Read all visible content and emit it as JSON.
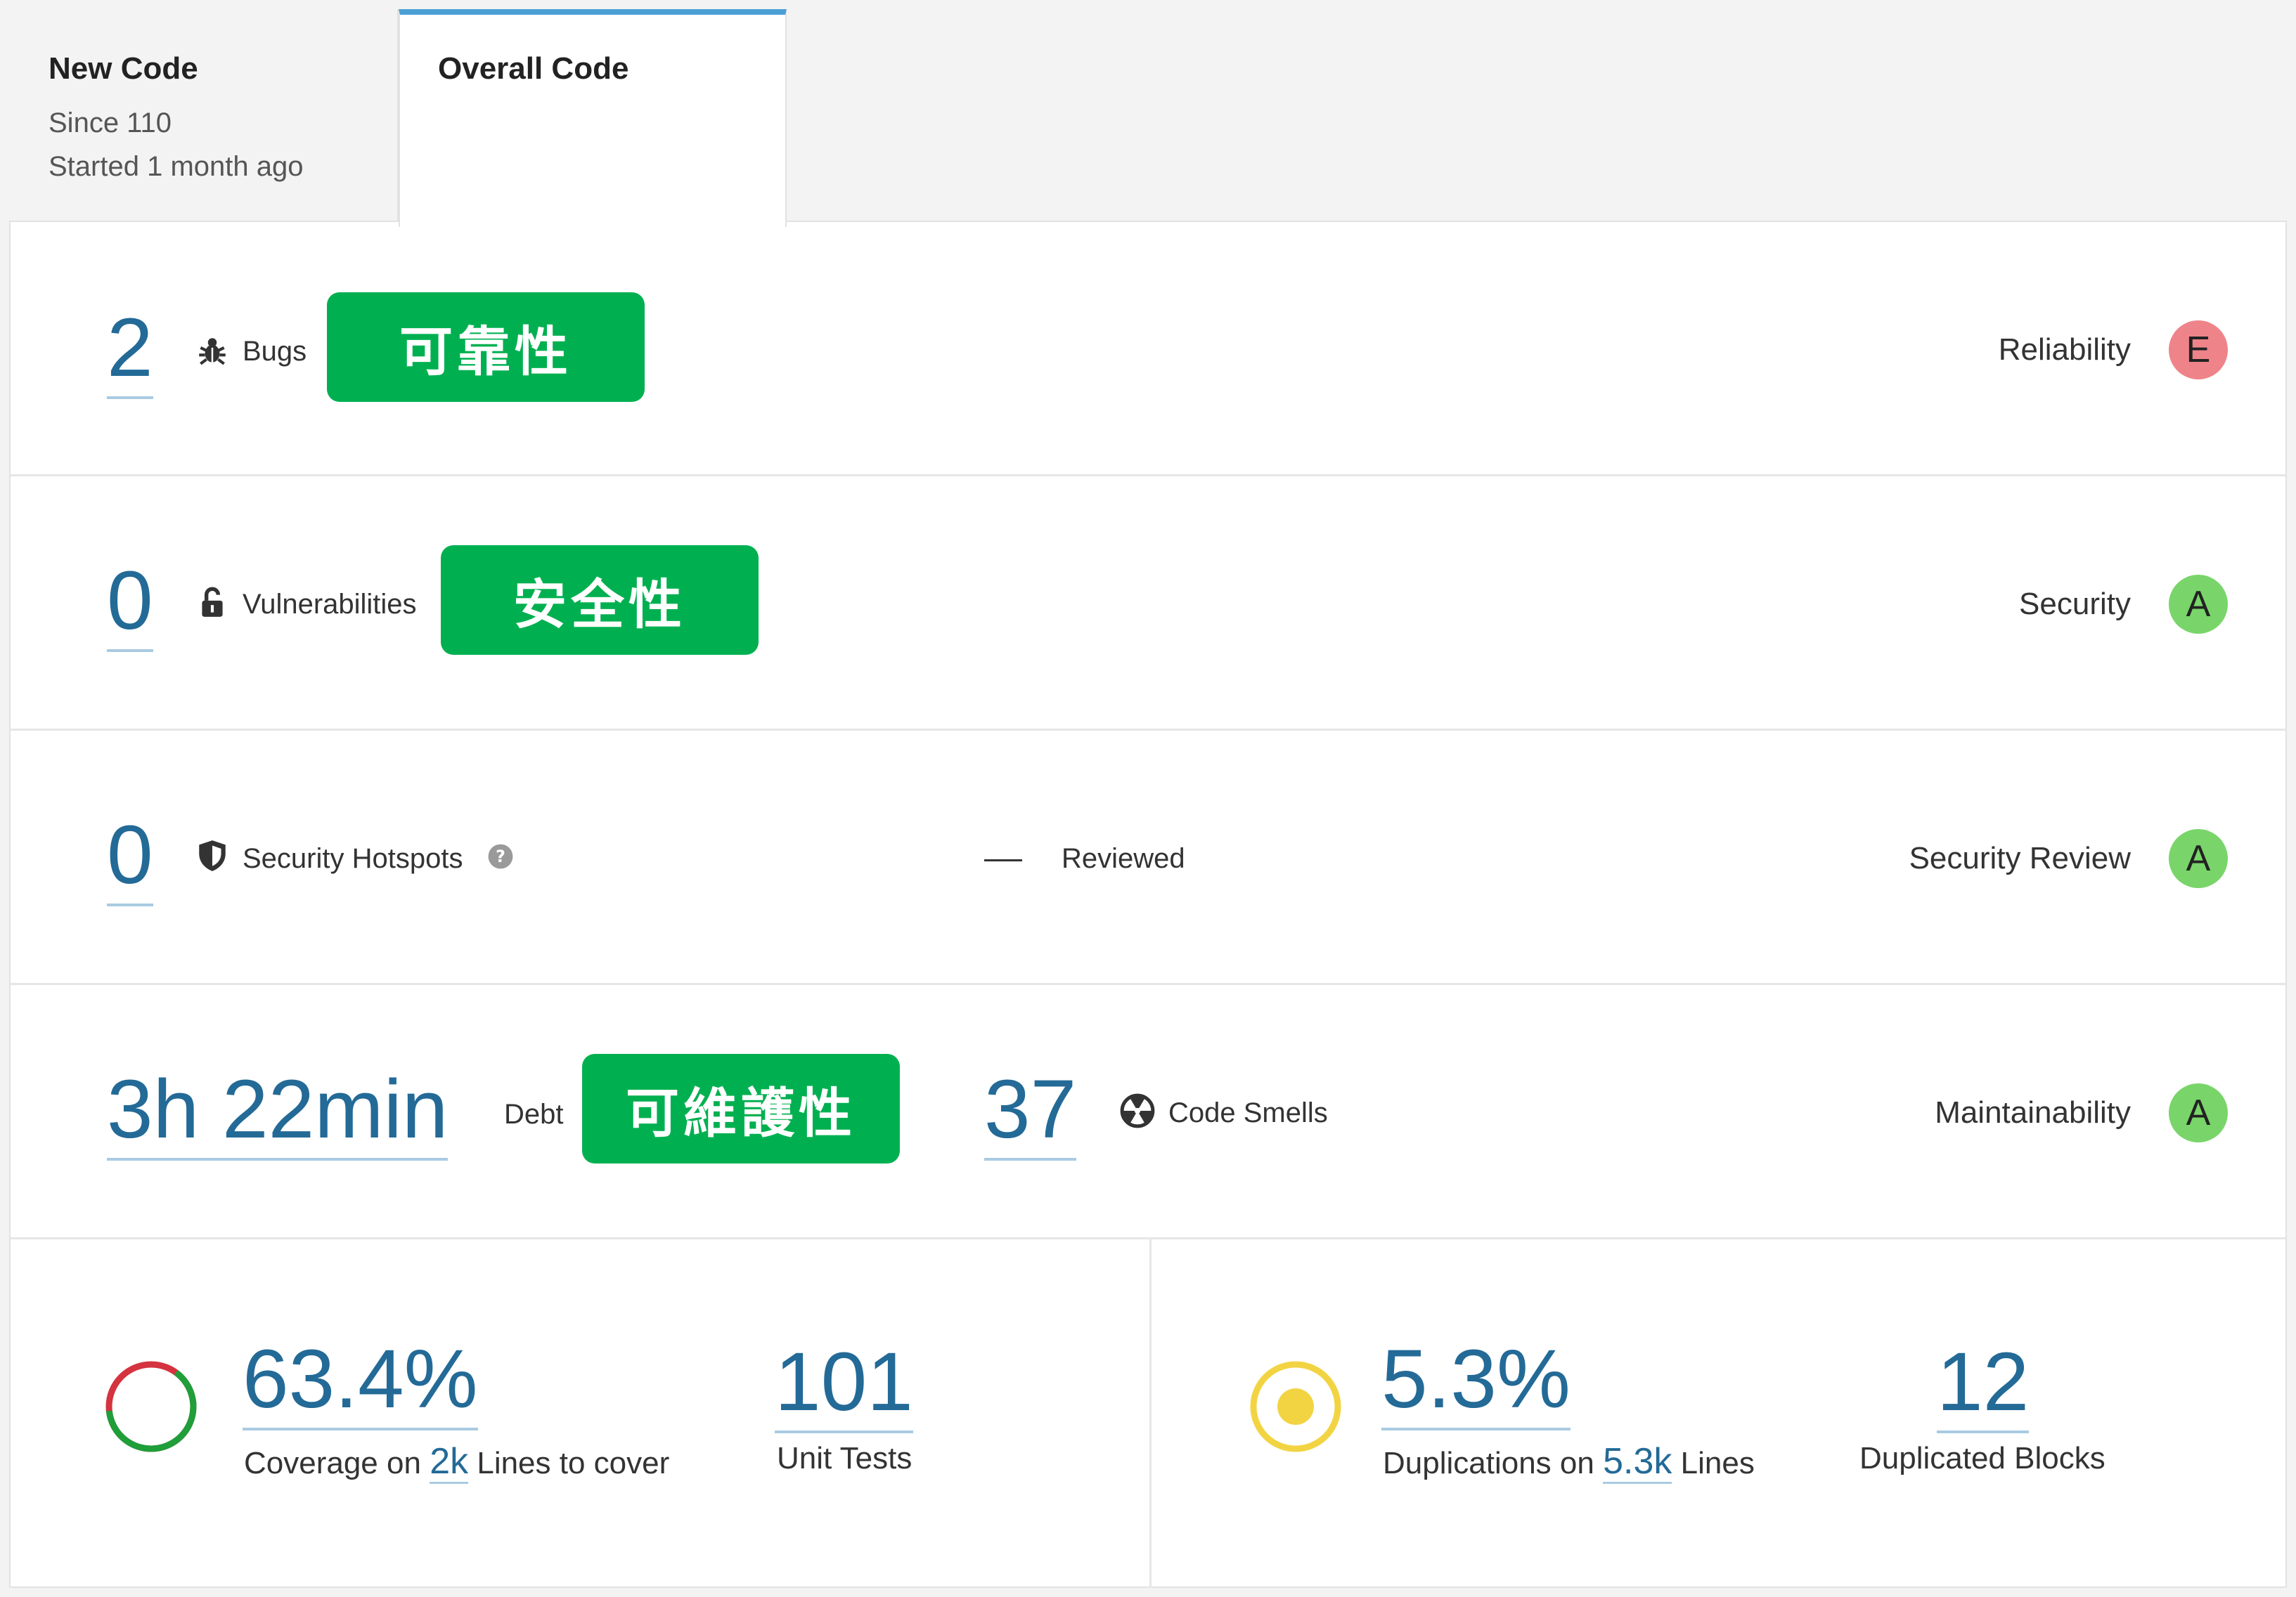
{
  "tabs": {
    "new_code": {
      "title": "New Code",
      "since": "Since 110",
      "started": "Started 1 month ago"
    },
    "overall_code": {
      "title": "Overall Code"
    }
  },
  "rows": {
    "bugs": {
      "value": "2",
      "label": "Bugs",
      "tag": "可靠性",
      "rating_label": "Reliability",
      "rating": "E",
      "icon": "bug-icon"
    },
    "vulnerabilities": {
      "value": "0",
      "label": "Vulnerabilities",
      "tag": "安全性",
      "rating_label": "Security",
      "rating": "A",
      "icon": "unlock-icon"
    },
    "hotspots": {
      "value": "0",
      "label": "Security Hotspots",
      "reviewed_value": "—",
      "reviewed_label": "Reviewed",
      "rating_label": "Security Review",
      "rating": "A",
      "icon": "shield-icon"
    },
    "maintainability": {
      "debt_value": "3h 22min",
      "debt_label": "Debt",
      "tag": "可維護性",
      "smells_value": "37",
      "smells_label": "Code Smells",
      "rating_label": "Maintainability",
      "rating": "A",
      "icon": "radiation-icon"
    }
  },
  "coverage": {
    "value": "63.4%",
    "label_prefix": "Coverage on",
    "lines_value": "2k",
    "label_suffix": "Lines to cover",
    "progress_fraction": 0.634,
    "unit_tests_value": "101",
    "unit_tests_label": "Unit Tests"
  },
  "duplications": {
    "value": "5.3%",
    "label_prefix": "Duplications on",
    "lines_value": "5.3k",
    "label_suffix": "Lines",
    "blocks_value": "12",
    "blocks_label": "Duplicated Blocks"
  },
  "colors": {
    "accent": "#236a97",
    "tag_green": "#00b050",
    "rating_e": "#ee8489",
    "rating_a": "#79d56a",
    "coverage_covered": "#1f9e3a",
    "coverage_uncovered": "#d4333f",
    "duplication_ring": "#f2d443"
  }
}
